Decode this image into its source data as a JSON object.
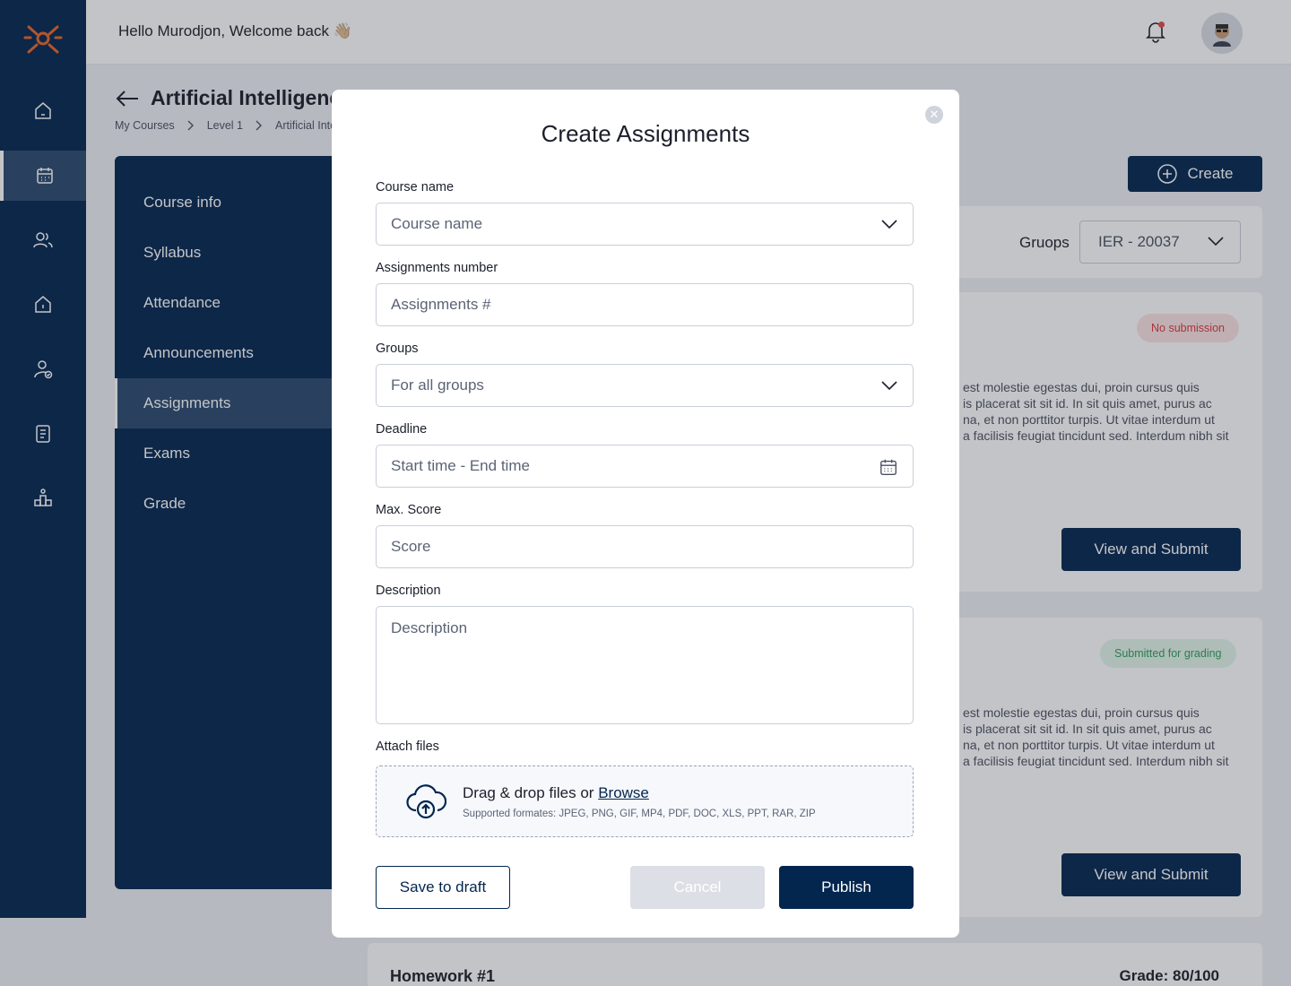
{
  "header": {
    "greeting": "Hello Murodjon, Welcome back 👋🏼"
  },
  "page": {
    "title": "Artificial Intelligence",
    "breadcrumb": [
      "My Courses",
      "Level 1",
      "Artificial Inte"
    ]
  },
  "course_nav": {
    "items": [
      {
        "label": "Course info"
      },
      {
        "label": "Syllabus"
      },
      {
        "label": "Attendance"
      },
      {
        "label": "Announcements"
      },
      {
        "label": "Assignments"
      },
      {
        "label": "Exams"
      },
      {
        "label": "Grade"
      }
    ],
    "active": "Assignments"
  },
  "content": {
    "create_label": "Create",
    "groups_label": "Gruops",
    "groups_value": "IER - 20037",
    "cards": [
      {
        "badge": "No submission",
        "lines": [
          "est molestie egestas dui, proin cursus quis",
          "is placerat sit sit id. In sit quis amet, purus ac",
          "na, et non porttitor turpis. Ut vitae interdum ut",
          "a facilisis feugiat tincidunt sed. Interdum nibh sit"
        ],
        "button": "View and Submit"
      },
      {
        "badge": "Submitted for grading",
        "lines": [
          "est molestie egestas dui, proin cursus quis",
          "is placerat sit sit id. In sit quis amet, purus ac",
          "na, et non porttitor turpis. Ut vitae interdum ut",
          "a facilisis feugiat tincidunt sed. Interdum nibh sit"
        ],
        "button": "View and Submit"
      }
    ],
    "homework": {
      "title": "Homework #1",
      "grade": "Grade: 80/100"
    }
  },
  "modal": {
    "title": "Create Assignments",
    "course_name_label": "Course name",
    "course_name_placeholder": "Course name",
    "assignment_number_label": "Assignments number",
    "assignment_number_placeholder": "Assignments #",
    "groups_label": "Groups",
    "groups_value": "For all groups",
    "deadline_label": "Deadline",
    "deadline_placeholder": "Start time - End time",
    "max_score_label": "Max. Score",
    "max_score_placeholder": "Score",
    "description_label": "Description",
    "description_placeholder": "Description",
    "attach_label": "Attach files",
    "drop_text": "Drag & drop files or",
    "browse_text": "Browse",
    "formats": "Supported formates: JPEG, PNG, GIF, MP4, PDF, DOC, XLS, PPT, RAR, ZIP",
    "save_draft": "Save to draft",
    "cancel": "Cancel",
    "publish": "Publish"
  },
  "colors": {
    "primary": "#03264f",
    "accent_logo": "#e8662a",
    "danger": "#d9363e",
    "success": "#2e9e5b"
  },
  "icons": {
    "rail": [
      "home-icon",
      "calendar-icon",
      "users-icon",
      "building-icon",
      "user-check-icon",
      "document-icon",
      "hierarchy-icon"
    ]
  }
}
